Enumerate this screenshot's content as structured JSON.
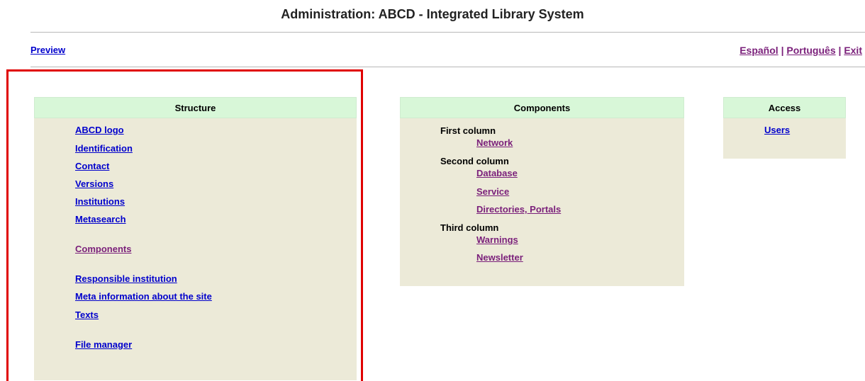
{
  "header": {
    "title": "Administration: ABCD - Integrated Library System"
  },
  "topnav": {
    "preview": "Preview",
    "languages": [
      "Español",
      "Português"
    ],
    "exit": "Exit",
    "separator": "|"
  },
  "structure": {
    "title": "Structure",
    "items": [
      "ABCD logo",
      "Identification",
      "Contact",
      "Versions",
      "Institutions",
      "Metasearch",
      "Components",
      "Responsible institution",
      "Meta information about the site",
      "Texts",
      "File manager"
    ]
  },
  "components": {
    "title": "Components",
    "first_column": {
      "label": "First column",
      "links": [
        "Network"
      ]
    },
    "second_column": {
      "label": "Second column",
      "links": [
        "Database",
        "Service",
        "Directories, Portals"
      ]
    },
    "third_column": {
      "label": "Third column",
      "links": [
        "Warnings",
        "Newsletter"
      ]
    }
  },
  "access": {
    "title": "Access",
    "items": [
      "Users"
    ]
  },
  "colors": {
    "link": "#0000cc",
    "visited_link": "#7a1f7a",
    "panel_header": "#d8f7d8",
    "panel_body": "#ecead8",
    "highlight": "#e00000"
  }
}
